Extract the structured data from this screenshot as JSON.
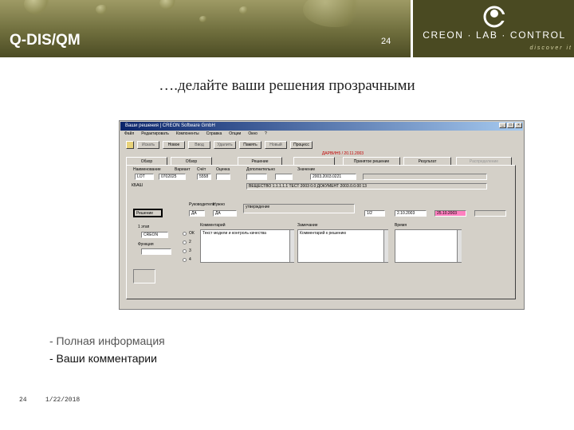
{
  "header": {
    "app_title": "Q-DIS/QM",
    "slide_number": "24",
    "logo_name": "CREON · LAB · CONTROL",
    "logo_tagline": "discover it"
  },
  "headline": "….делайте ваши решения прозрачными",
  "window": {
    "title": "Ваши решения | CREON Software GmbH",
    "menu": [
      "Файл",
      "Редактировать",
      "Компоненты",
      "Справка",
      "Опции",
      "Окно",
      "?"
    ],
    "toolbar": [
      {
        "label": "Искать",
        "enabled": false
      },
      {
        "label": "Новое",
        "enabled": true
      },
      {
        "label": "Ввод",
        "enabled": false
      },
      {
        "label": "Удалить",
        "enabled": false
      },
      {
        "label": "Память",
        "enabled": true
      },
      {
        "label": "Новый",
        "enabled": false
      },
      {
        "label": "Процесс",
        "enabled": true
      }
    ],
    "status_line": "ДАРВИН5 / 20.11.2003",
    "tabs": [
      {
        "label": "Обзор",
        "enabled": true
      },
      {
        "label": "Обзор",
        "enabled": true
      },
      {
        "label": "Решение",
        "enabled": true
      },
      {
        "label": "",
        "enabled": false
      },
      {
        "label": "Принятое решение",
        "enabled": true
      },
      {
        "label": "Результат",
        "enabled": true
      },
      {
        "label": "Распределение",
        "enabled": false
      }
    ],
    "form": {
      "col_labels": [
        "Наименование",
        "Вариант",
        "Счёт",
        "Оценка",
        "Дополнительно",
        "Значение"
      ],
      "row1_values": [
        "LOT",
        "0702025",
        "5558",
        "",
        "",
        "2003.2003.0221"
      ],
      "row2_label": "КБАШ",
      "row2_value": "ВЕЩЕСТВО 1.1.1.1.1 ТЕСТ 2003 0.0 ДОКУМЕНТ 2003.0.0.00 13",
      "decision_button": "Решение",
      "mid_labels": [
        "Руководитель",
        "Нужно"
      ],
      "mid_values": [
        "ДА",
        "ДА"
      ],
      "approval_label": "Утверждение",
      "approval_value": "утверждение",
      "right_vals": [
        "1/2",
        "2.10.2003",
        "25.10.2003"
      ],
      "left_label_1": "1 этап",
      "left_value_1": "CREON",
      "left_label_2": "Функция",
      "radio_labels": [
        "ОК",
        "2",
        "3",
        "4"
      ],
      "comment_title_1": "Комментарий",
      "comment_value_1": "Текст модели и контроль качества",
      "comment_title_2": "Замечание",
      "comment_value_2": "Комментарий к решению",
      "small_right_label": "Время"
    }
  },
  "bullets": [
    {
      "text": "- Полная информация",
      "color": "#555555"
    },
    {
      "text": "- Ваши комментарии",
      "color": "#111111"
    }
  ],
  "footer": {
    "page": "24",
    "date": "1/22/2018"
  }
}
